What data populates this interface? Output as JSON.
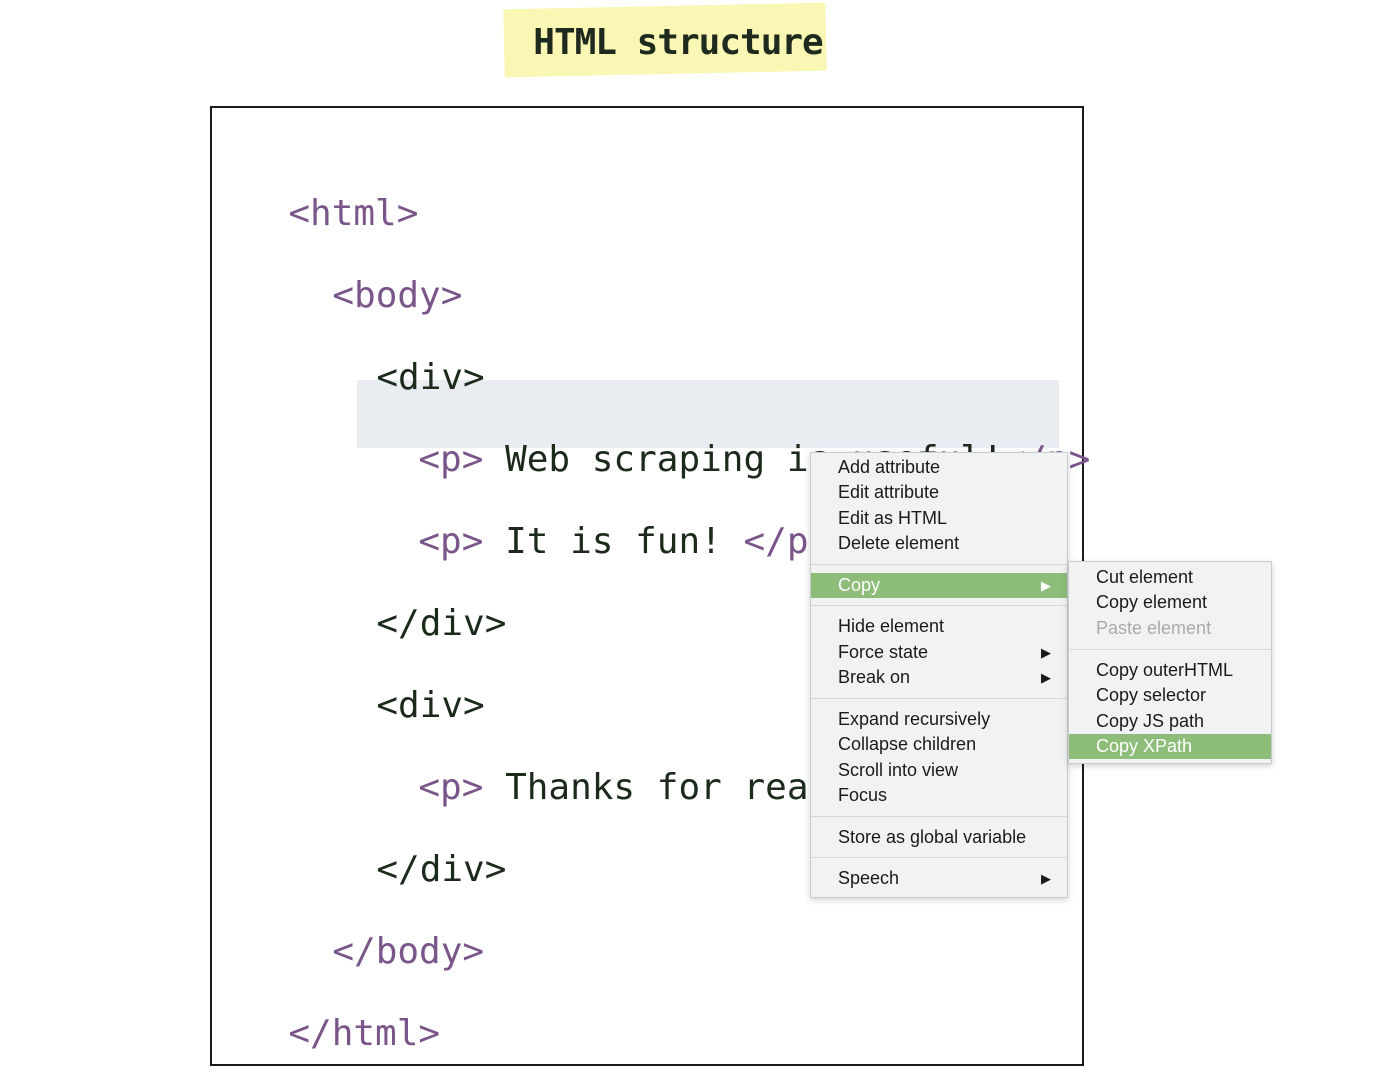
{
  "title": "HTML structure",
  "code": {
    "html_open": "<html>",
    "body_open": "<body>",
    "div1_open": "<div>",
    "p1_tag_open": "<p>",
    "p1_text": " Web scraping is useful!",
    "p1_tag_close": "</p>",
    "p2_tag_open": "<p>",
    "p2_text": " It is fun! ",
    "p2_tag_close": "</p>",
    "div1_close": "</div>",
    "div2_open": "<div>",
    "p3_tag_open": "<p>",
    "p3_text": " Thanks for readi",
    "div2_close": "</div>",
    "body_close": "</body>",
    "html_close": "</html>"
  },
  "context_menu": {
    "items": [
      "Add attribute",
      "Edit attribute",
      "Edit as HTML",
      "Delete element",
      "Copy",
      "Hide element",
      "Force state",
      "Break on",
      "Expand recursively",
      "Collapse children",
      "Scroll into view",
      "Focus",
      "Store as global variable",
      "Speech"
    ],
    "active_item": "Copy"
  },
  "copy_submenu": {
    "items": [
      "Cut element",
      "Copy element",
      "Paste element",
      "Copy outerHTML",
      "Copy selector",
      "Copy JS path",
      "Copy XPath"
    ],
    "disabled_item": "Paste element",
    "active_item": "Copy XPath"
  },
  "icons": {
    "submenu_arrow": "triangle-right-icon"
  },
  "colors": {
    "tag": "#7a5589",
    "text": "#1b2a1b",
    "highlight_row": "#e9edf2",
    "menu_active": "#8dbd79",
    "title_marker": "#faf6b4"
  }
}
